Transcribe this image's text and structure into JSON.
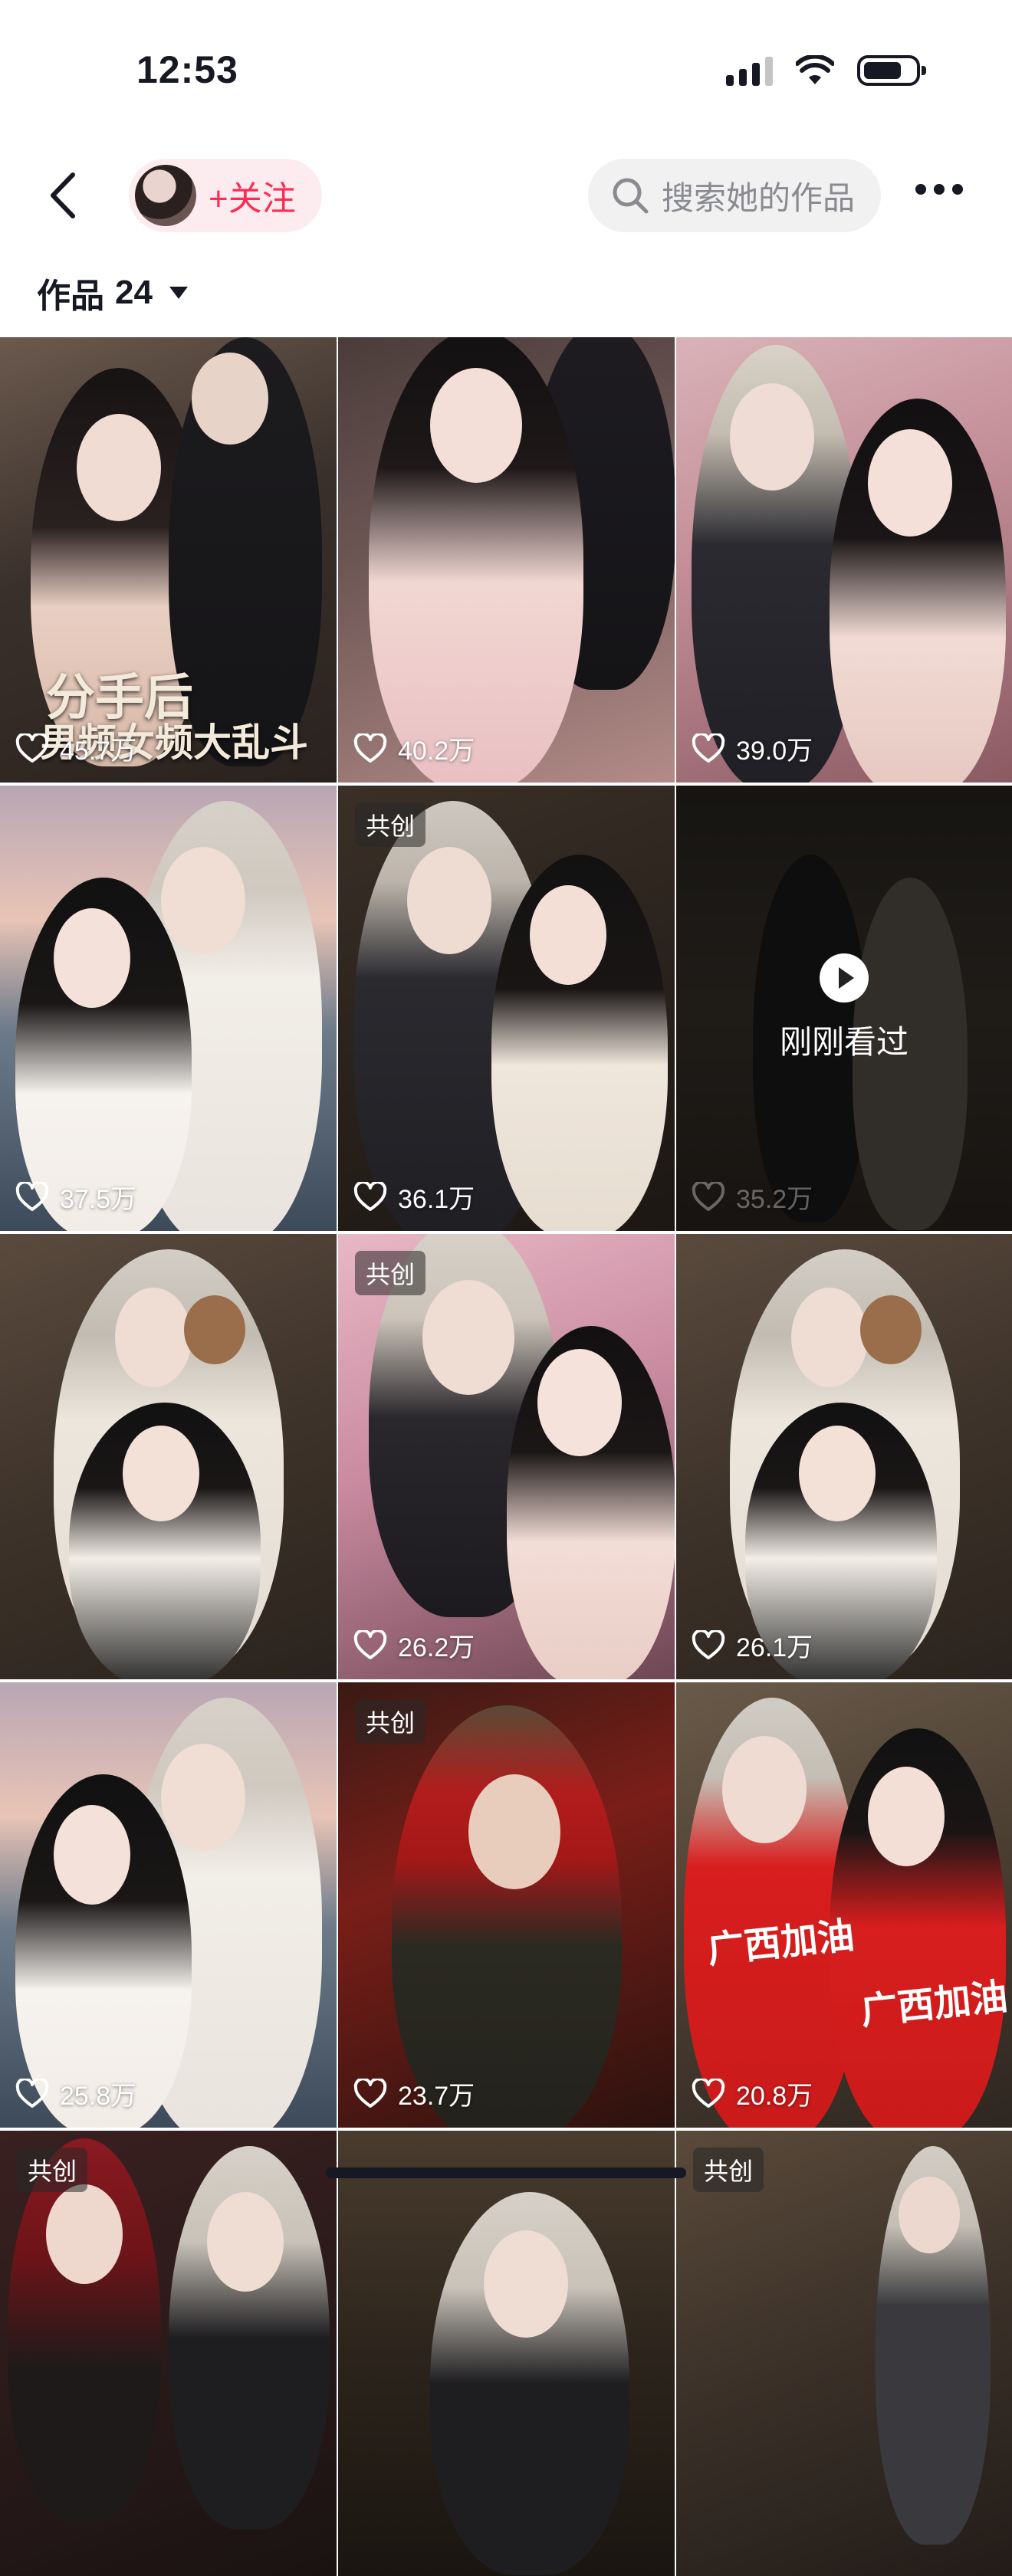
{
  "status_bar": {
    "time": "12:53"
  },
  "header": {
    "follow_label": "+关注",
    "search_placeholder": "搜索她的作品"
  },
  "works": {
    "label": "作品",
    "count": "24"
  },
  "tiles": [
    {
      "likes": "45.7万",
      "title_line1": "分手后",
      "title_line2": "男频女频大乱斗"
    },
    {
      "likes": "40.2万"
    },
    {
      "likes": "39.0万"
    },
    {
      "likes": "37.5万"
    },
    {
      "likes": "36.1万",
      "badge": "共创"
    },
    {
      "likes": "35.2万",
      "watched_label": "刚刚看过"
    },
    {
      "likes": ""
    },
    {
      "likes": "26.2万",
      "badge": "共创"
    },
    {
      "likes": "26.1万"
    },
    {
      "likes": "25.8万"
    },
    {
      "likes": "23.7万",
      "badge": "共创"
    },
    {
      "likes": "20.8万",
      "shirt_text": "广西加油"
    },
    {
      "badge": "共创"
    },
    {},
    {
      "badge": "共创"
    }
  ],
  "colors": {
    "accent": "#fe2c55"
  }
}
